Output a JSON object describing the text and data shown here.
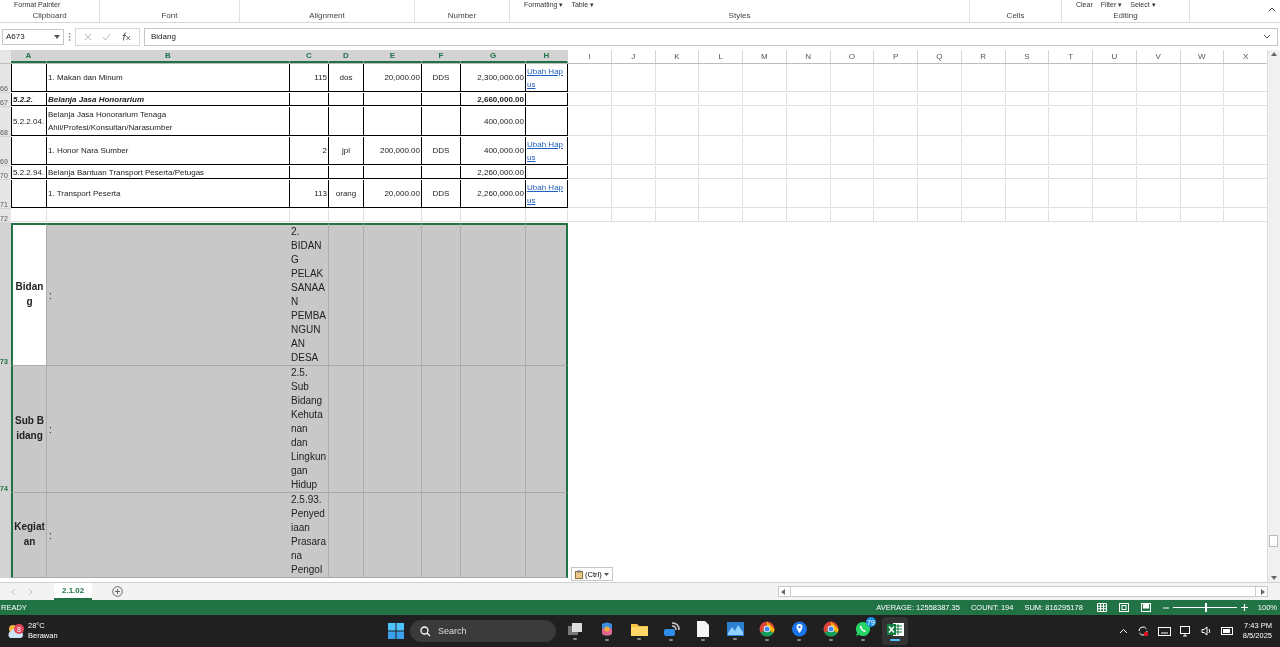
{
  "ribbon": {
    "groups": [
      {
        "label": "Clipboard",
        "items": [
          "Format Painter"
        ]
      },
      {
        "label": "Font"
      },
      {
        "label": "Alignment"
      },
      {
        "label": "Number"
      },
      {
        "label": "Styles",
        "items": [
          "Formatting ▾",
          "Table ▾"
        ]
      },
      {
        "label": "Cells"
      },
      {
        "label": "Editing",
        "items": [
          "Clear",
          "Filter ▾",
          "Select ▾"
        ]
      }
    ]
  },
  "formula_bar": {
    "name_box": "A673",
    "value": "Bidang"
  },
  "columns": [
    {
      "label": "A",
      "selected": true
    },
    {
      "label": "B",
      "selected": true
    },
    {
      "label": "C",
      "selected": true
    },
    {
      "label": "D",
      "selected": true
    },
    {
      "label": "E",
      "selected": true
    },
    {
      "label": "F",
      "selected": true
    },
    {
      "label": "G",
      "selected": true
    },
    {
      "label": "H",
      "selected": true
    },
    {
      "label": "I",
      "selected": false
    },
    {
      "label": "J",
      "selected": false
    },
    {
      "label": "K",
      "selected": false
    },
    {
      "label": "L",
      "selected": false
    },
    {
      "label": "M",
      "selected": false
    },
    {
      "label": "N",
      "selected": false
    },
    {
      "label": "O",
      "selected": false
    },
    {
      "label": "P",
      "selected": false
    },
    {
      "label": "Q",
      "selected": false
    },
    {
      "label": "R",
      "selected": false
    },
    {
      "label": "S",
      "selected": false
    },
    {
      "label": "T",
      "selected": false
    },
    {
      "label": "U",
      "selected": false
    },
    {
      "label": "V",
      "selected": false
    },
    {
      "label": "W",
      "selected": false
    },
    {
      "label": "X",
      "selected": false
    }
  ],
  "rows": [
    {
      "number": "66",
      "kind": "item",
      "selected": false,
      "cells": {
        "B": "1. Makan dan Minum",
        "C": "115",
        "D": "dos",
        "E": "20,000.00",
        "F": "DDS",
        "G": "2,300,000.00",
        "H": "Ubah Hapus"
      }
    },
    {
      "number": "67",
      "kind": "heading",
      "selected": false,
      "cells": {
        "A": "5.2.2.",
        "B": "Belanja Jasa Honorarium",
        "G": "2,660,000.00"
      }
    },
    {
      "number": "68",
      "kind": "account",
      "selected": false,
      "cells": {
        "A": "5.2.2.04.",
        "B": "Belanja Jasa Honorarium Tenaga Ahli/Profesi/Konsultan/Narasumber",
        "G": "400,000.00"
      }
    },
    {
      "number": "69",
      "kind": "item",
      "selected": false,
      "cells": {
        "B": "1. Honor Nara Sumber",
        "C": "2",
        "D": "jpl",
        "E": "200,000.00",
        "F": "DDS",
        "G": "400,000.00",
        "H": "Ubah Hapus"
      }
    },
    {
      "number": "70",
      "kind": "account",
      "selected": false,
      "cells": {
        "A": "5.2.2.94.",
        "B": "Belanja Bantuan Transport Peserta/Petugas",
        "G": "2,260,000.00"
      }
    },
    {
      "number": "71",
      "kind": "item",
      "selected": false,
      "cells": {
        "B": "1. Transport Peserta",
        "C": "113",
        "D": "orang",
        "E": "20,000.00",
        "F": "DDS",
        "G": "2,260,000.00",
        "H": "Ubah Hapus"
      }
    },
    {
      "number": "72",
      "kind": "blank",
      "selected": false
    },
    {
      "number": "73",
      "kind": "section",
      "selected": true,
      "active": true,
      "cells": {
        "A": "Bidang",
        "B": ":",
        "C": "2. BIDANG PELAKSANAAN PEMBANGUNAN DESA"
      }
    },
    {
      "number": "74",
      "kind": "section",
      "selected": true,
      "active": false,
      "cells": {
        "A": "Sub Bidang",
        "B": ":",
        "C": "2.5. Sub Bidang Kehutanan dan Lingkungan Hidup"
      }
    },
    {
      "kind": "section",
      "selected": true,
      "active": false,
      "cells": {
        "A": "Kegiatan",
        "B": ":",
        "C": "2.5.93. Penyediaan Prasarana Pengol"
      }
    }
  ],
  "paste_options": "(Ctrl)",
  "sheet_tabs": [
    {
      "label": "2.1.02",
      "selected": true
    }
  ],
  "status_bar": {
    "mode": "READY",
    "stats": [
      "AVERAGE: 12558387.35",
      "COUNT: 194",
      "SUM: 816295178"
    ],
    "zoom": {
      "label": "100%",
      "level": 0.5
    }
  },
  "taskbar": {
    "weather": {
      "badge": "8",
      "temperature": "28°C",
      "condition": "Berawan"
    },
    "search": {
      "placeholder": "Search"
    },
    "apps": [
      {
        "kind": "task-view",
        "selected": false
      },
      {
        "kind": "copilot",
        "selected": false
      },
      {
        "kind": "folder",
        "selected": false
      },
      {
        "kind": "network",
        "selected": false
      },
      {
        "kind": "document",
        "selected": false
      },
      {
        "kind": "chart-window",
        "selected": false
      },
      {
        "kind": "browser",
        "selected": false
      },
      {
        "kind": "location",
        "selected": false
      },
      {
        "kind": "browser",
        "selected": false
      },
      {
        "kind": "chat",
        "selected": false,
        "badge": "79"
      },
      {
        "kind": "spreadsheet",
        "selected": true
      }
    ],
    "time": "7:43 PM",
    "date": "8/5/2025"
  }
}
